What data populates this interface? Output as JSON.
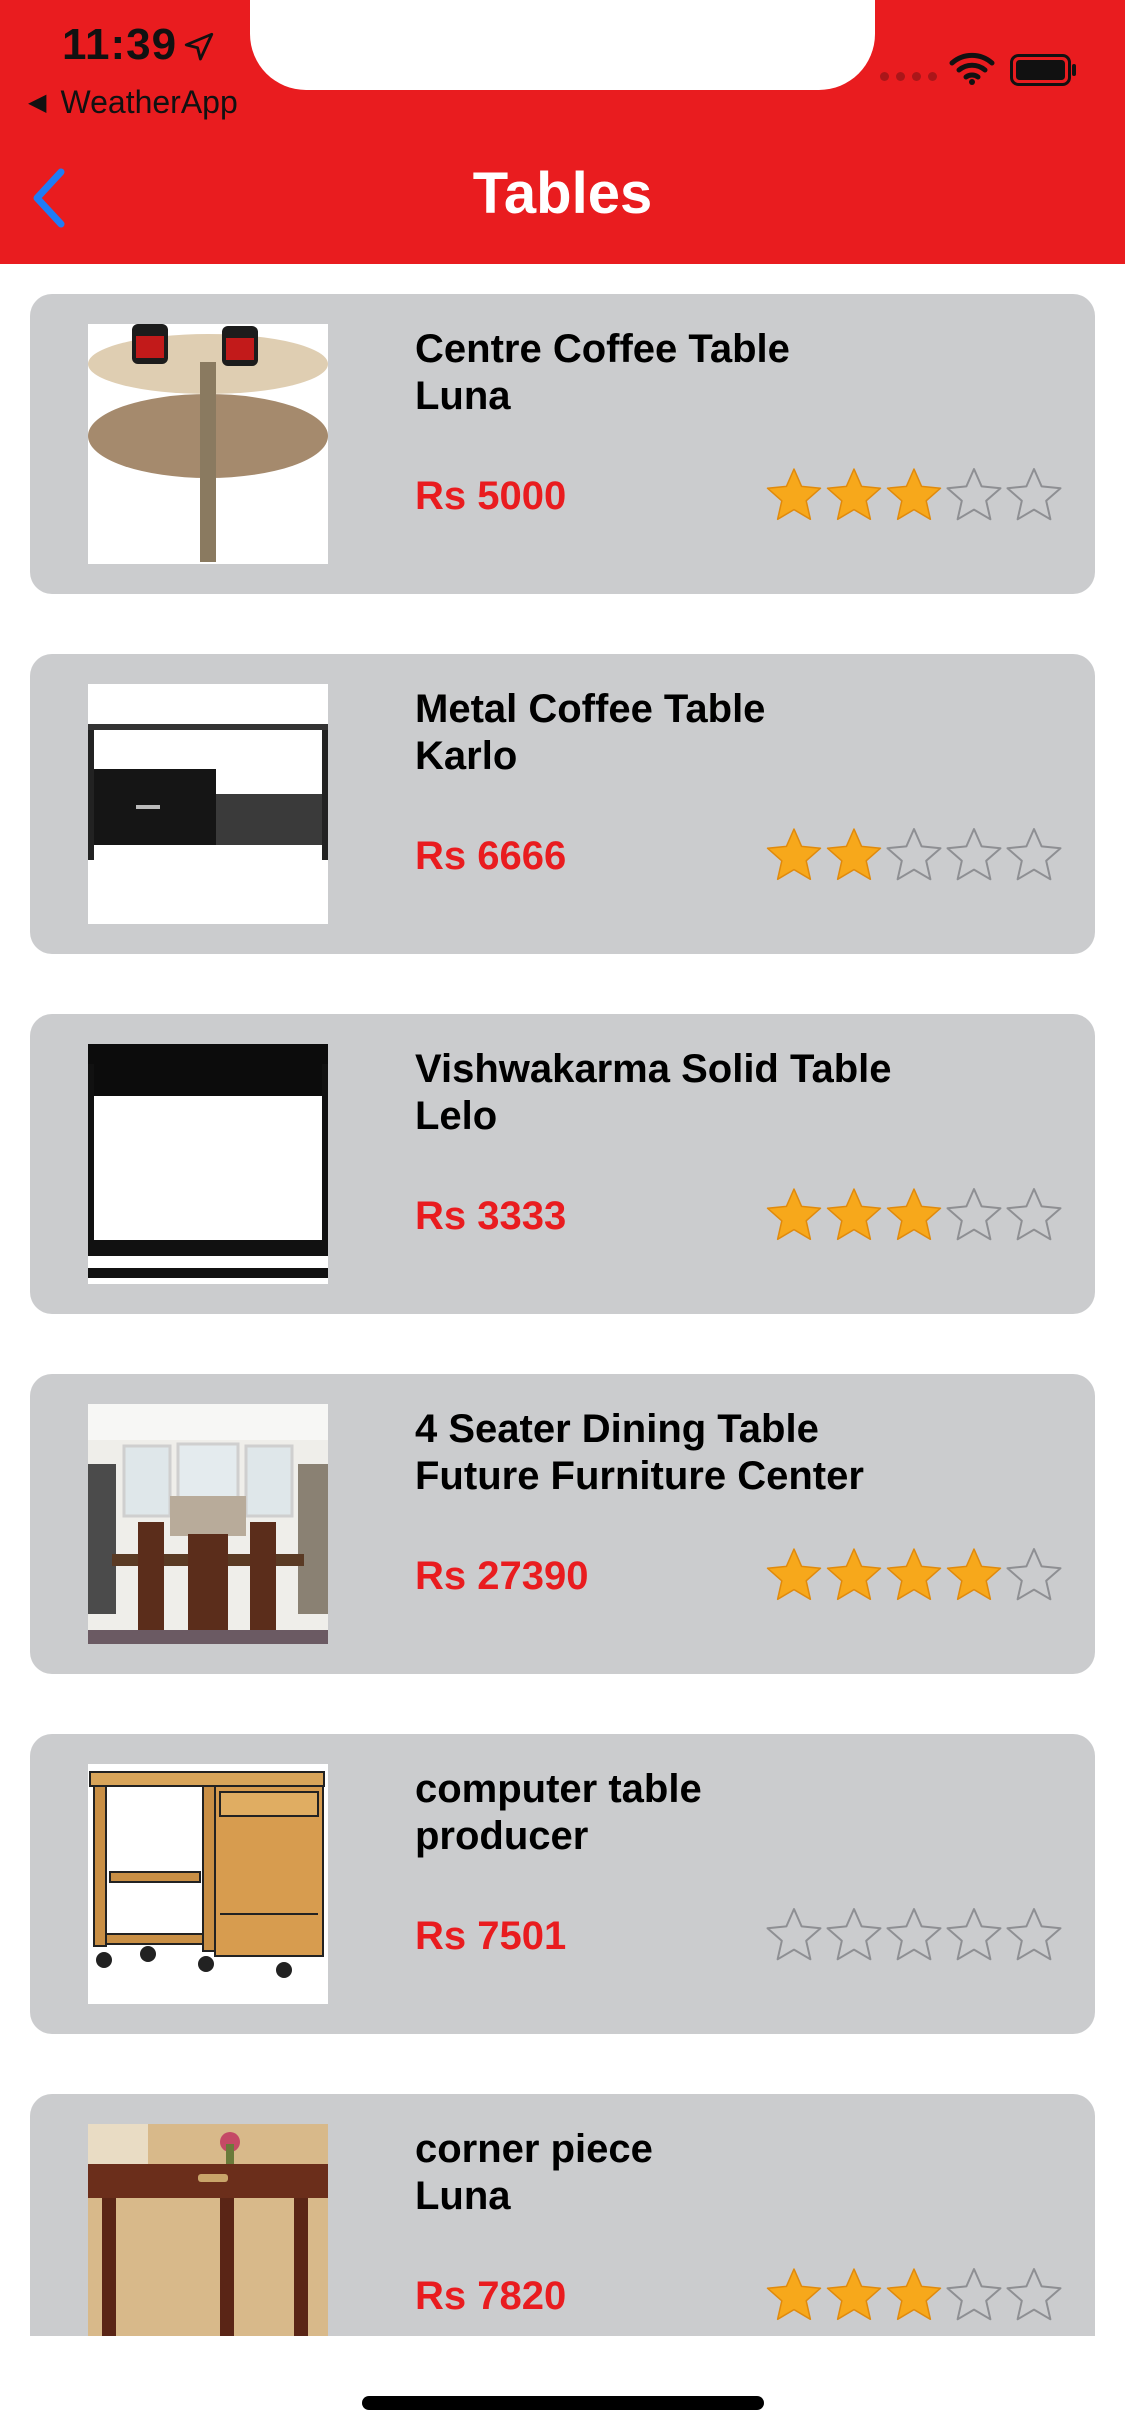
{
  "status_bar": {
    "time": "11:39",
    "back_app": "WeatherApp"
  },
  "nav": {
    "title": "Tables",
    "back_icon": "chevron-left-icon"
  },
  "colors": {
    "brand_red": "#e91c1f",
    "card_bg": "#cbccce",
    "star_fill": "#f7a81b",
    "back_blue": "#1f7cf5"
  },
  "products": [
    {
      "line1": "Centre Coffee Table",
      "line2": "Luna",
      "price": "Rs 5000",
      "rating": 3
    },
    {
      "line1": "Metal Coffee Table",
      "line2": "Karlo",
      "price": "Rs 6666",
      "rating": 2
    },
    {
      "line1": "Vishwakarma Solid Table",
      "line2": "Lelo",
      "price": "Rs 3333",
      "rating": 3
    },
    {
      "line1": "4 Seater Dining Table",
      "line2": "Future Furniture Center",
      "price": "Rs 27390",
      "rating": 4
    },
    {
      "line1": "computer table",
      "line2": "producer",
      "price": "Rs 7501",
      "rating": 0
    },
    {
      "line1": "corner piece",
      "line2": "Luna",
      "price": "Rs 7820",
      "rating": 3
    }
  ]
}
